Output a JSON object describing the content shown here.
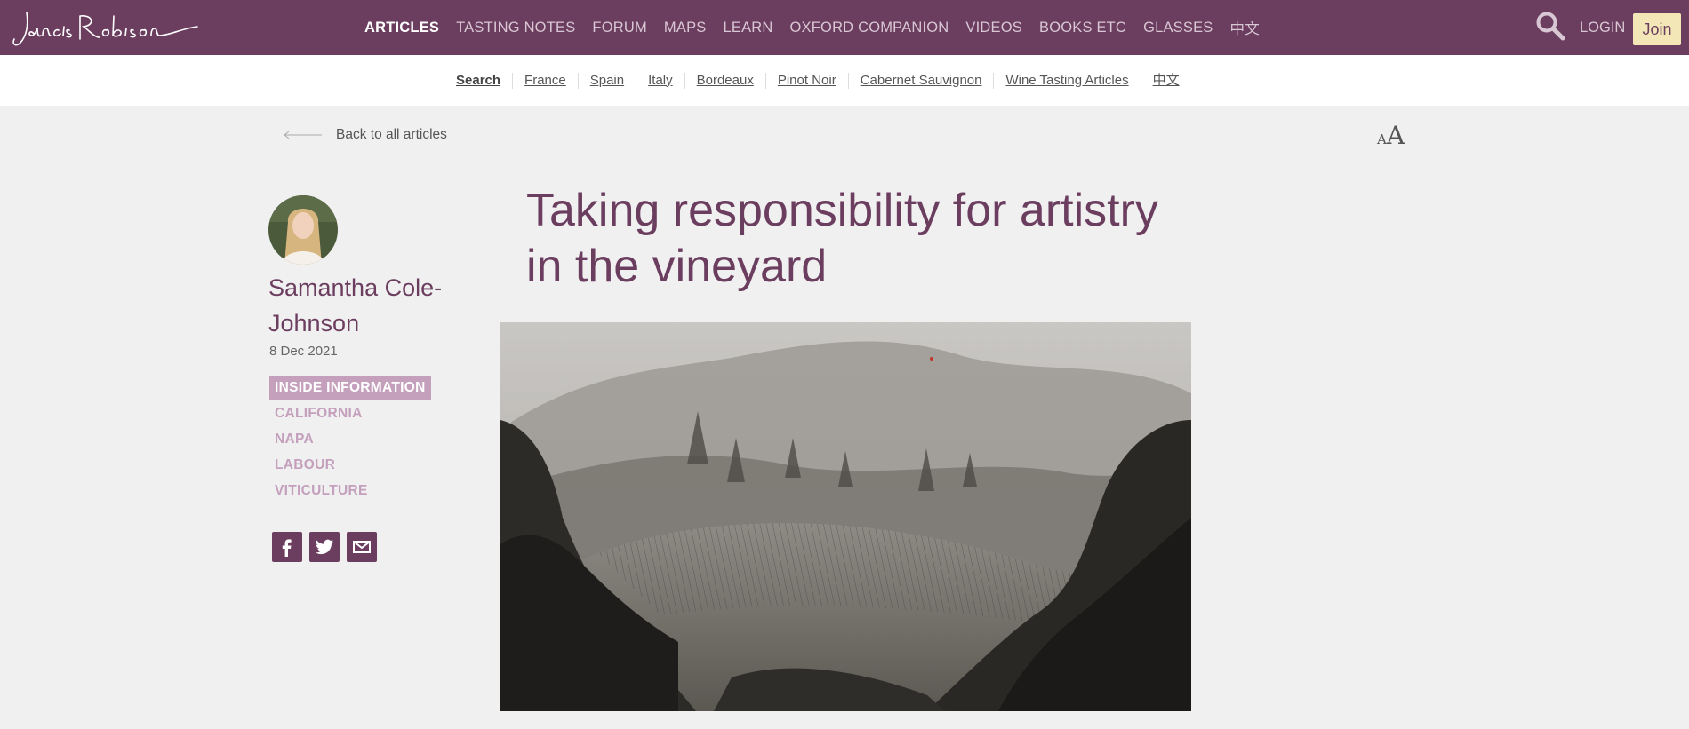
{
  "brand": {
    "name": "Jancis Robinson"
  },
  "nav": {
    "items": [
      "ARTICLES",
      "TASTING NOTES",
      "FORUM",
      "MAPS",
      "LEARN",
      "OXFORD COMPANION",
      "VIDEOS",
      "BOOKS ETC",
      "GLASSES",
      "中文"
    ],
    "login": "LOGIN",
    "join": "Join"
  },
  "subnav": [
    "Search",
    "France",
    "Spain",
    "Italy",
    "Bordeaux",
    "Pinot Noir",
    "Cabernet Sauvignon",
    "Wine Tasting Articles",
    "中文"
  ],
  "back": {
    "label": "Back to all articles"
  },
  "font_toggle": {
    "small": "A",
    "big": "A"
  },
  "article": {
    "title": "Taking responsibility for artistry in the vineyard",
    "author": "Samantha Cole-Johnson",
    "date": "8 Dec 2021",
    "tags": [
      "INSIDE INFORMATION",
      "CALIFORNIA",
      "NAPA",
      "LABOUR",
      "VITICULTURE"
    ]
  },
  "colors": {
    "brand": "#6b3d5f",
    "join_bg": "#f3e7b8",
    "tag": "#c4a0bd",
    "page_bg": "#f0f0f0"
  },
  "icons": {
    "search": "search-icon",
    "facebook": "facebook-icon",
    "twitter": "twitter-icon",
    "email": "email-icon",
    "back": "arrow-left-icon"
  }
}
